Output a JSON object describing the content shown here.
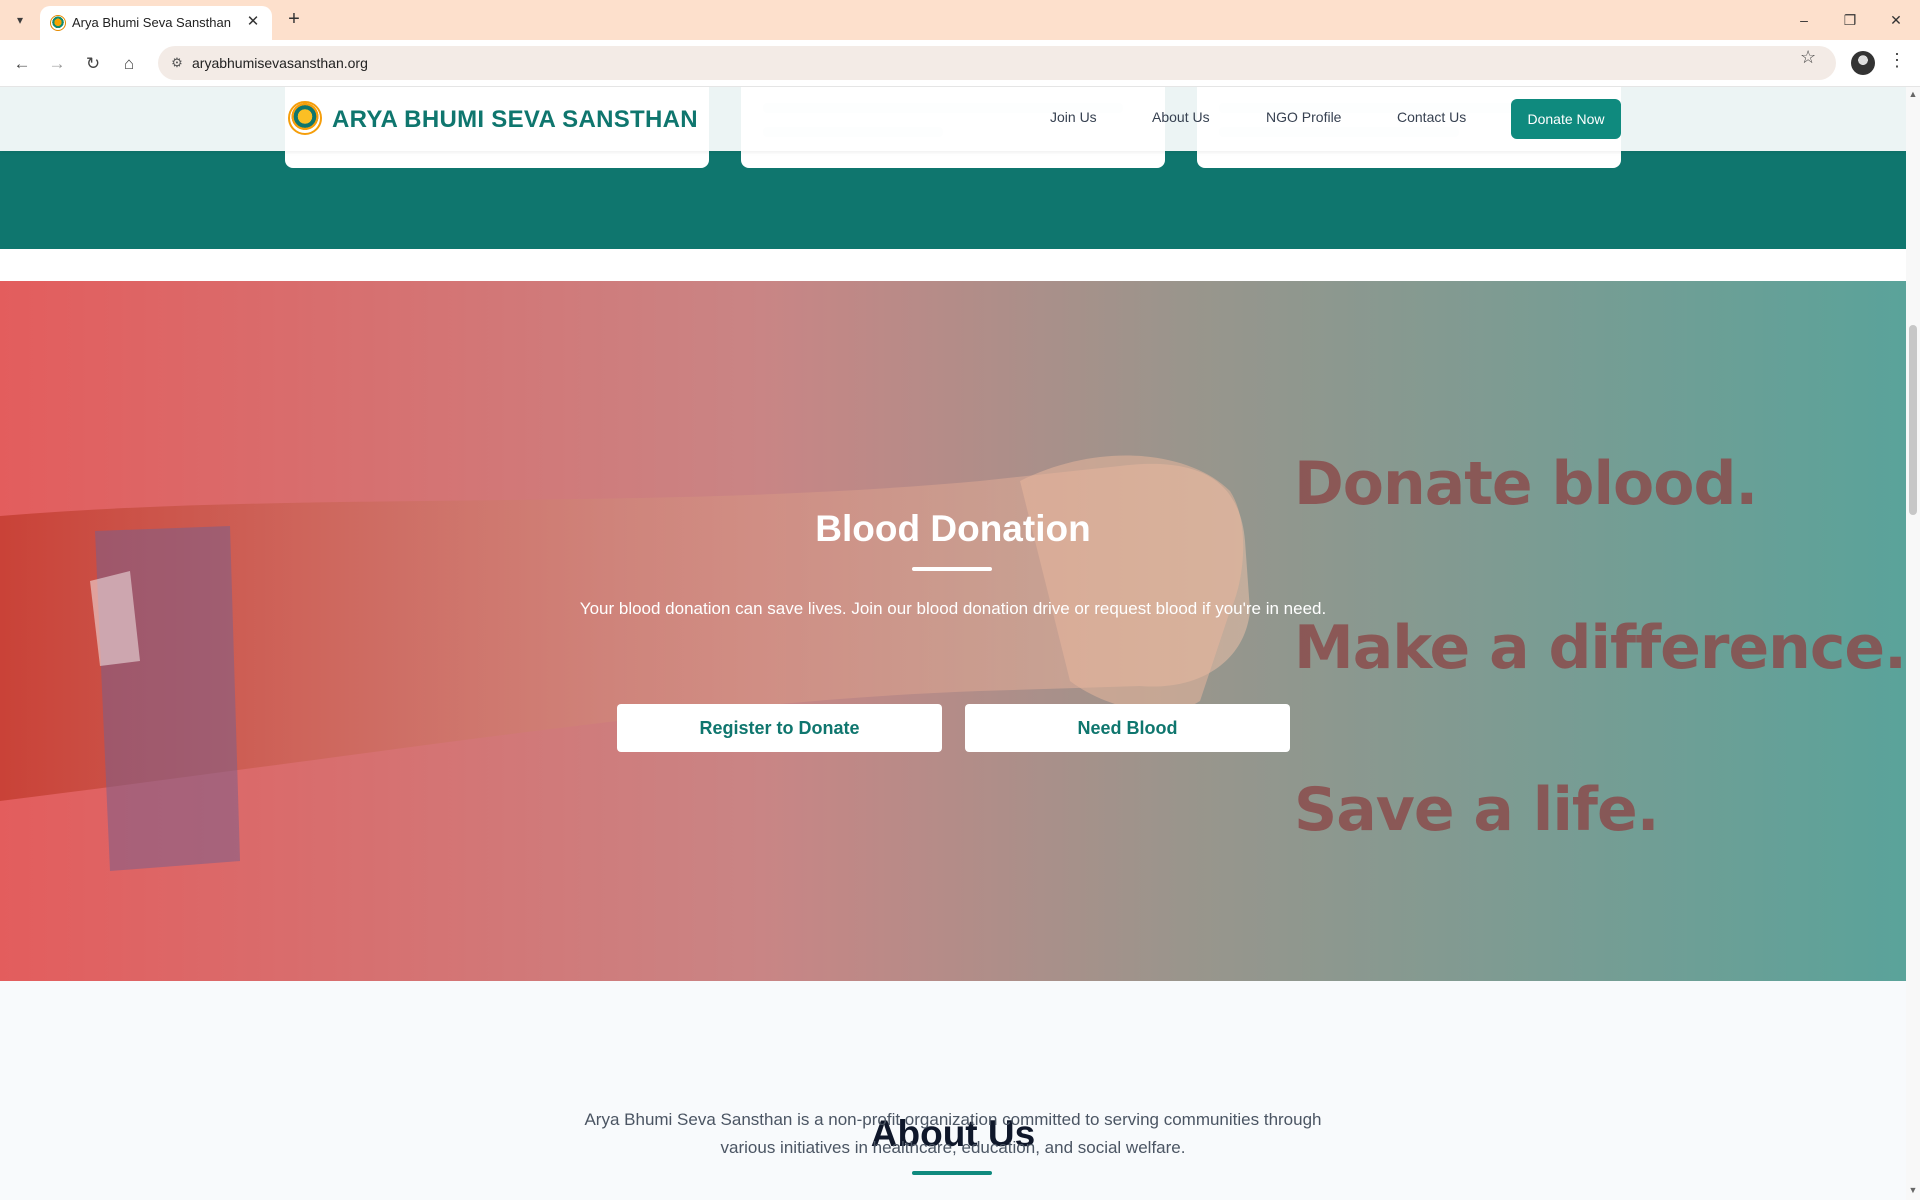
{
  "browser": {
    "tab_title": "Arya Bhumi Seva Sansthan",
    "tab_close": "✕",
    "new_tab": "+",
    "url": "aryabhumisevasansthan.org",
    "window_controls": {
      "minimize": "–",
      "restore": "❐",
      "close": "✕"
    }
  },
  "navbar": {
    "logo_text": "ARYA BHUMI SEVA SANSTHAN",
    "links": [
      "Join Us",
      "About Us",
      "NGO Profile",
      "Contact Us"
    ],
    "cta": "Donate Now"
  },
  "hero": {
    "slogans": [
      "Donate blood.",
      "Make a difference.",
      "Save a life."
    ],
    "title": "Blood Donation",
    "text": "Your blood donation can save lives. Join our blood donation drive or request blood if you're in need.",
    "buttons": [
      "Register to Donate",
      "Need Blood"
    ]
  },
  "about": {
    "title": "About Us",
    "text": "Arya Bhumi Seva Sansthan is a non-profit organization committed to serving communities through various initiatives in healthcare, education, and social welfare."
  },
  "colors": {
    "brand_teal": "#0f766e",
    "accent_teal": "#0f8a7e",
    "hero_red": "#e35d5d",
    "slogan_maroon": "#8b4a4a"
  }
}
